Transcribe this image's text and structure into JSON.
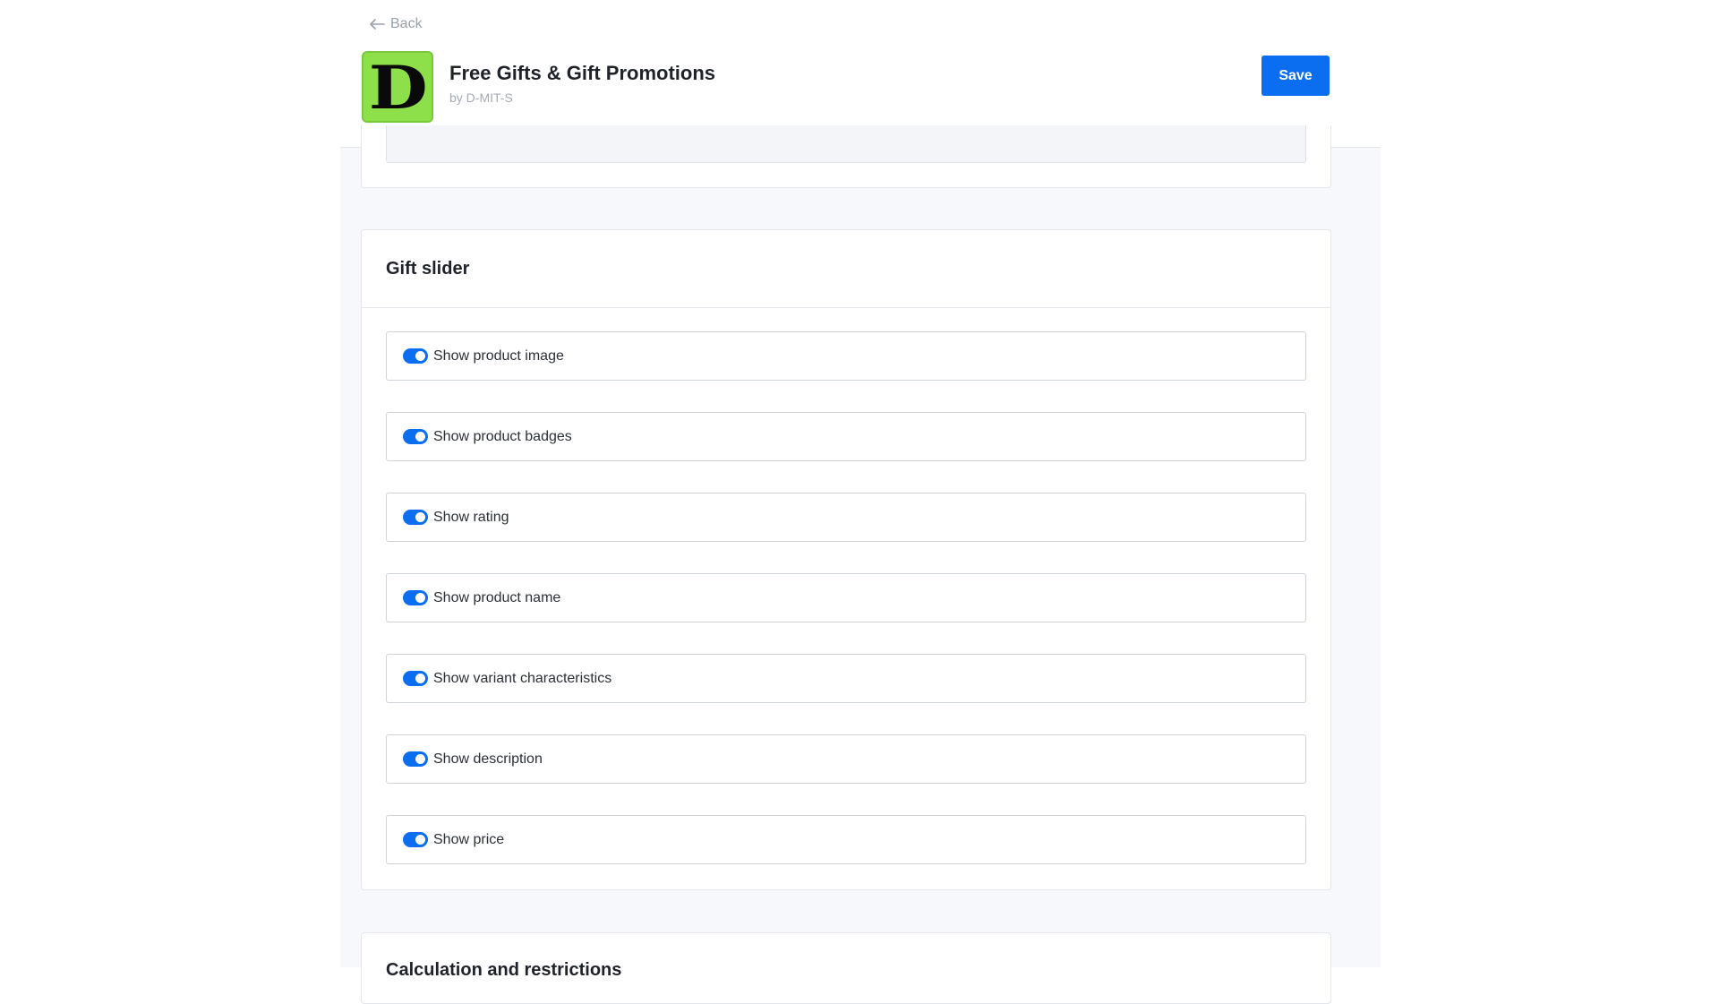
{
  "header": {
    "back_label": "Back",
    "app_title": "Free Gifts & Gift Promotions",
    "vendor": "by D-MIT-S",
    "logo_letter": "D",
    "save_label": "Save"
  },
  "gift_slider": {
    "title": "Gift slider",
    "options": [
      {
        "label": "Show product image",
        "enabled": true
      },
      {
        "label": "Show product badges",
        "enabled": true
      },
      {
        "label": "Show rating",
        "enabled": true
      },
      {
        "label": "Show product name",
        "enabled": true
      },
      {
        "label": "Show variant characteristics",
        "enabled": true
      },
      {
        "label": "Show description",
        "enabled": true
      },
      {
        "label": "Show price",
        "enabled": true
      }
    ]
  },
  "next_section": {
    "title": "Calculation and restrictions"
  },
  "colors": {
    "accent": "#0b6ef0",
    "logo_bg": "#8ee04a"
  }
}
